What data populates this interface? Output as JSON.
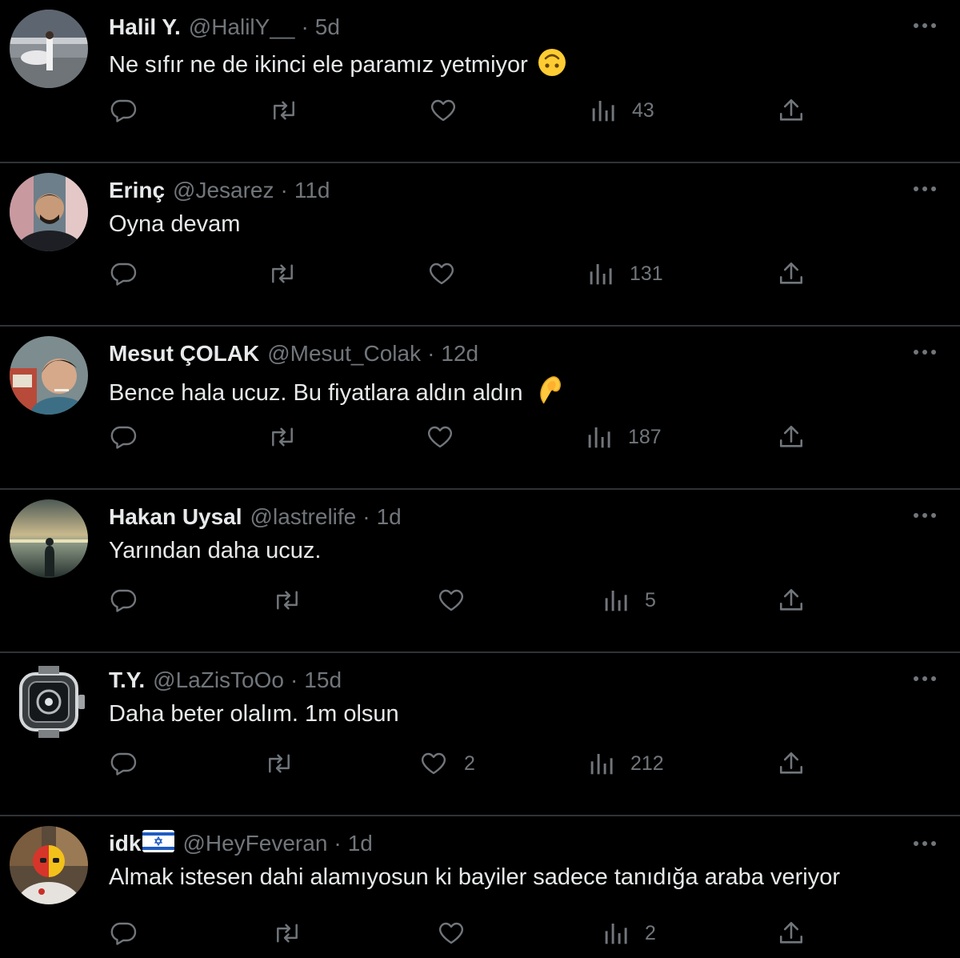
{
  "tweets": [
    {
      "name": "Halil Y.",
      "handle": "@HalilY__",
      "time": "5d",
      "text": "Ne sıfır ne de ikinci ele paramız yetmiyor",
      "emoji": "upside-down-face-emoji",
      "replies": "",
      "retweets": "",
      "likes": "",
      "views": "43"
    },
    {
      "name": "Erinç",
      "handle": "@Jesarez",
      "time": "11d",
      "text": "Oyna devam",
      "emoji": "",
      "replies": "",
      "retweets": "",
      "likes": "",
      "views": "131"
    },
    {
      "name": "Mesut ÇOLAK",
      "handle": "@Mesut_Colak",
      "time": "12d",
      "text": "Bence hala ucuz. Bu fiyatlara aldın aldın",
      "emoji": "pinched-fingers-emoji",
      "replies": "",
      "retweets": "",
      "likes": "",
      "views": "187"
    },
    {
      "name": "Hakan Uysal",
      "handle": "@lastrelife",
      "time": "1d",
      "text": "Yarından daha ucuz.",
      "emoji": "",
      "replies": "",
      "retweets": "",
      "likes": "",
      "views": "5"
    },
    {
      "name": "T.Y.",
      "handle": "@LaZisToOo",
      "time": "15d",
      "text": "Daha beter olalım. 1m olsun",
      "emoji": "",
      "replies": "",
      "retweets": "",
      "likes": "2",
      "views": "212"
    },
    {
      "name": "idk",
      "handle": "@HeyFeveran",
      "time": "1d",
      "text": "Almak istesen dahi alamıyosun ki bayiler sadece tanıdığa araba veriyor",
      "emoji": "",
      "name_flag": "israel-flag-emoji",
      "replies": "",
      "retweets": "",
      "likes": "",
      "views": "2"
    }
  ],
  "sep": "·",
  "colors": {
    "background": "#000000",
    "text": "#e7e9ea",
    "muted": "#71767b",
    "divider": "#2f3336"
  }
}
